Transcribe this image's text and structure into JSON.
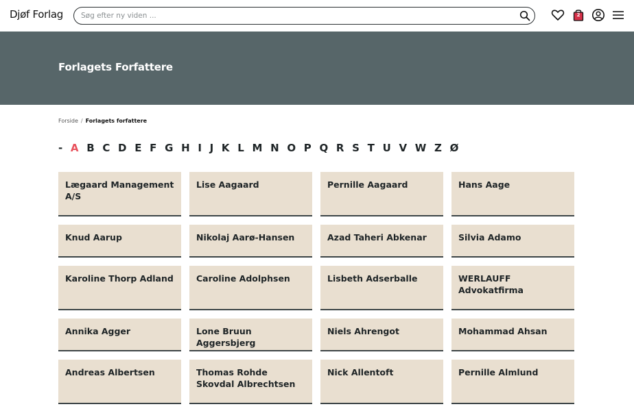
{
  "header": {
    "logo": "Djøf Forlag",
    "search_placeholder": "Søg efter ny viden ...",
    "cart_count": "2"
  },
  "banner": {
    "title": "Forlagets Forfattere"
  },
  "breadcrumb": {
    "home": "Forside",
    "separator": "/",
    "current": "Forlagets forfattere"
  },
  "alphabet": {
    "letters": [
      "-",
      "A",
      "B",
      "C",
      "D",
      "E",
      "F",
      "G",
      "H",
      "I",
      "J",
      "K",
      "L",
      "M",
      "N",
      "O",
      "P",
      "Q",
      "R",
      "S",
      "T",
      "U",
      "V",
      "W",
      "Z",
      "Ø"
    ],
    "active": "A",
    "active_color": "#e8505b"
  },
  "authors": [
    "Lægaard Management A/S",
    "Lise Aagaard",
    "Pernille Aagaard",
    "Hans Aage",
    "Knud Aarup",
    "Nikolaj Aarø-Hansen",
    "Azad Taheri Abkenar",
    "Silvia Adamo",
    "Karoline Thorp Adland",
    "Caroline Adolphsen",
    "Lisbeth Adserballe",
    "WERLAUFF Advokatfirma",
    "Annika Agger",
    "Lone Bruun Aggersbjerg",
    "Niels Ahrengot",
    "Mohammad Ahsan",
    "Andreas Albertsen",
    "Thomas Rohde Skovdal Albrechtsen",
    "Nick Allentoft",
    "Pernille Almlund"
  ],
  "colors": {
    "banner": "#576669",
    "card": "#e9dfd0",
    "cart": "#d6324a"
  }
}
